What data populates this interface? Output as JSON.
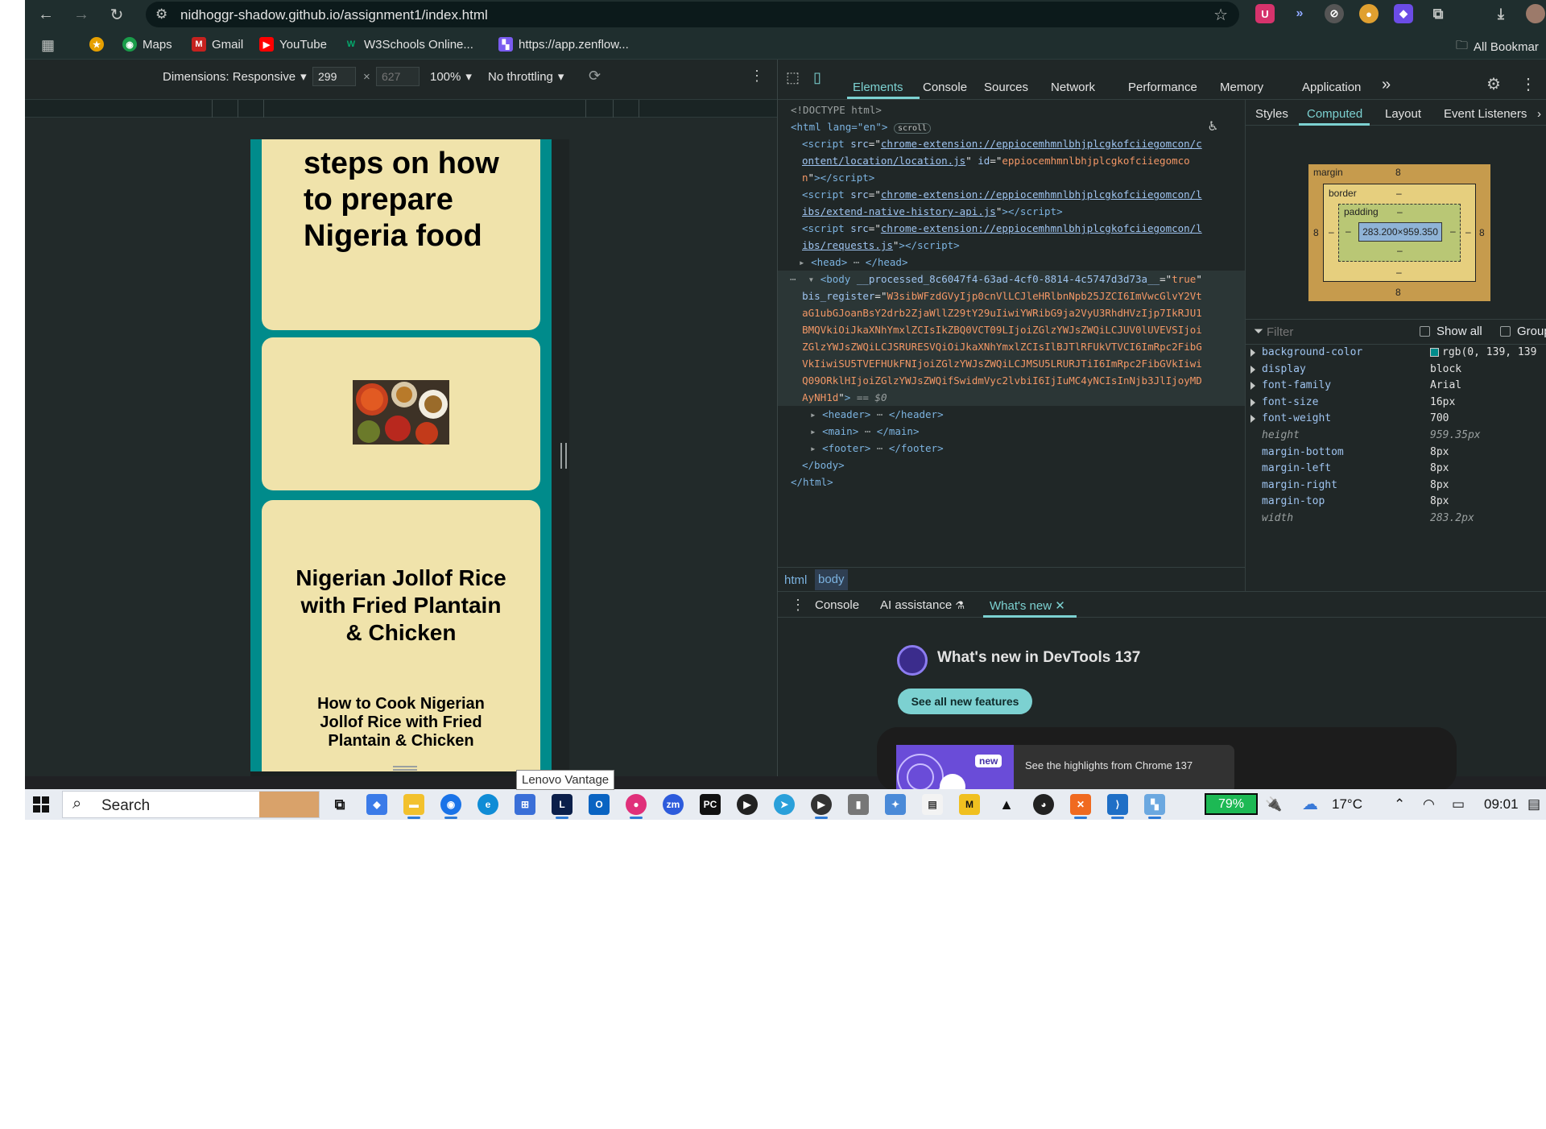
{
  "browser": {
    "url": "nidhoggr-shadow.github.io/assignment1/index.html",
    "bookmarks": [
      {
        "label": "Maps"
      },
      {
        "label": "Gmail"
      },
      {
        "label": "YouTube"
      },
      {
        "label": "W3Schools Online..."
      },
      {
        "label": "https://app.zenflow..."
      }
    ],
    "all_bookmarks": "All Bookmar"
  },
  "device_toolbar": {
    "dimensions_label": "Dimensions: Responsive",
    "width": "299",
    "height_placeholder": "627",
    "times": "×",
    "zoom": "100%",
    "throttling": "No throttling"
  },
  "page": {
    "card1_title": "steps on how to prepare Nigeria food",
    "card3_title": "Nigerian Jollof Rice with Fried Plantain & Chicken",
    "card3_subtitle": "How to Cook Nigerian Jollof Rice with Fried Plantain & Chicken"
  },
  "tooltip": "Lenovo Vantage",
  "devtools": {
    "tabs": [
      "Elements",
      "Console",
      "Sources",
      "Network",
      "Performance",
      "Memory",
      "Application"
    ],
    "more_tabs": "»",
    "active_tab": "Elements",
    "breadcrumbs": [
      "html",
      "body"
    ],
    "side_tabs": [
      "Styles",
      "Computed",
      "Layout",
      "Event Listeners"
    ],
    "box_model": {
      "margin_label": "margin",
      "border_label": "border",
      "padding_label": "padding",
      "margin": "8",
      "dash": "–",
      "content": "283.200×959.350"
    },
    "filter_placeholder": "Filter",
    "show_all": "Show all",
    "group": "Group",
    "computed": [
      {
        "name": "background-color",
        "value": "rgb(0, 139, 139",
        "swatch": "#008b8b"
      },
      {
        "name": "display",
        "value": "block"
      },
      {
        "name": "font-family",
        "value": "Arial"
      },
      {
        "name": "font-size",
        "value": "16px"
      },
      {
        "name": "font-weight",
        "value": "700"
      },
      {
        "name": "height",
        "value": "959.35px"
      },
      {
        "name": "margin-bottom",
        "value": "8px"
      },
      {
        "name": "margin-left",
        "value": "8px"
      },
      {
        "name": "margin-right",
        "value": "8px"
      },
      {
        "name": "margin-top",
        "value": "8px"
      },
      {
        "name": "width",
        "value": "283.2px"
      }
    ],
    "drawer_tabs": [
      "Console",
      "AI assistance",
      "What's new"
    ],
    "whats_new_title": "What's new in DevTools 137",
    "see_all": "See all new features",
    "highlight_badge": "new",
    "highlight_text": "See the highlights from Chrome 137",
    "dom": {
      "doctype": "<!DOCTYPE html>",
      "html_open": "<html lang=\"en\">",
      "scroll_badge": "scroll",
      "script1_src_a": "chrome-extension://eppiocemhmnlbhjplcgkofciiegomcon/c",
      "script1_src_b": "ontent/location/location.js",
      "script1_id_a": "eppiocemhmnlbhjplcgkofciiegomco",
      "script1_id_b": "n",
      "script2_src_a": "chrome-extension://eppiocemhmnlbhjplcgkofciiegomcon/l",
      "script2_src_b": "ibs/extend-native-history-api.js",
      "script3_src_a": "chrome-extension://eppiocemhmnlbhjplcgkofciiegomcon/l",
      "script3_src_b": "ibs/requests.js",
      "head": "<head>",
      "head_close": "</head>",
      "body_attr": "__processed_8c6047f4-63ad-4cf0-8814-4c5747d3d73a__",
      "body_attr_val": "true",
      "bis_register_lines": [
        "W3sibWFzdGVyIjp0cnVlLCJleHRlbnNpb25JZCI6ImVwcGlvY2Vt",
        "aG1ubGJoanBsY2drb2ZjaWllZ29tY29uIiwiYWRibG9ja2VyU3RhdHVzIjp7IkRJU1",
        "BMQVkiOiJkaXNhYmxlZCIsIkZBQ0VCT09LIjoiZGlzYWJsZWQiLCJUV0lUVEVSIjoi",
        "ZGlzYWJsZWQiLCJSRURESVQiOiJkaXNhYmxlZCIsIlBJTlRFUkVTVCI6ImRpc2FibG",
        "VkIiwiSU5TVEFHUkFNIjoiZGlzYWJsZWQiLCJMSU5LRURJTiI6ImRpc2FibGVkIiwi",
        "Q09ORklHIjoiZGlzYWJsZWQifSwidmVyc2lvbiI6IjIuMC4yNCIsInNjb3JlIjoyMD",
        "AyNH1d"
      ],
      "dollar0": "== $0",
      "header": "<header>",
      "header_close": "</header>",
      "main": "<main>",
      "main_close": "</main>",
      "footer": "<footer>",
      "footer_close": "</footer>",
      "body_close": "</body>",
      "html_close": "</html>"
    }
  },
  "taskbar": {
    "search": "Search",
    "battery": "79%",
    "weather": "17°C",
    "time": "09:01"
  }
}
